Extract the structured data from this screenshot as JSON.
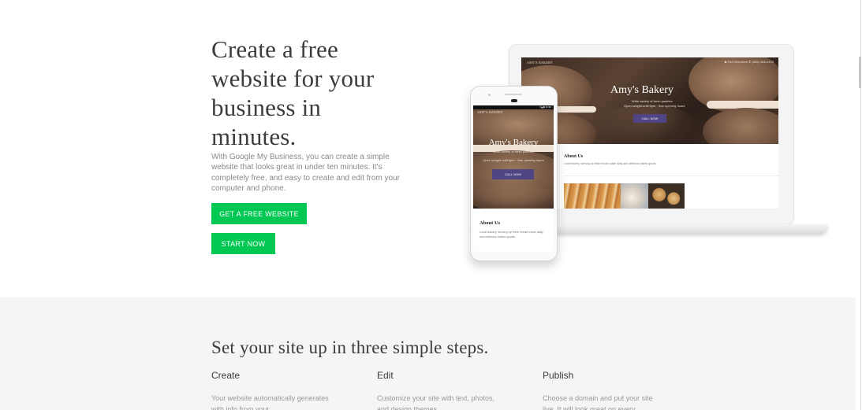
{
  "hero": {
    "title": "Create a free website for your business in minutes.",
    "description": "With Google My Business, you can create a simple website that looks great in under ten minutes. It's completely free, and easy to create and edit from your computer and phone.",
    "primary_button": "GET A FREE WEBSITE",
    "secondary_button": "START NOW",
    "button_color": "#00c853"
  },
  "laptop_preview": {
    "brand": "AMY'S BAKERY",
    "nav_right": "◆ Get Directions   ✆ (555) 555-0123",
    "title": "Amy's Bakery",
    "tagline": "Wide variety of fresh pastries",
    "hours": "Open tonight until 6pm · See opening hours",
    "call_button": "CALL NOW",
    "about_title": "About Us",
    "about_text": "Local bakery, serving up fresh bread made daily and delicious baked goods.",
    "accent_color": "#4f4584"
  },
  "phone_preview": {
    "status_text": "▾◢ ▮ 12:30",
    "brand": "AMY'S BAKERY",
    "title": "Amy's Bakery",
    "tagline": "Wide variety of fresh pastries",
    "hours": "Open tonight until 6pm · See opening hours",
    "call_button": "CALL NOW",
    "about_title": "About Us",
    "about_text": "Local bakery, serving up fresh bread made daily and delicious baked goods."
  },
  "steps_section": {
    "title": "Set your site up in three simple steps.",
    "background_color": "#f5f5f5",
    "steps": [
      {
        "heading": "Create",
        "text": "Your website automatically generates with info from your"
      },
      {
        "heading": "Edit",
        "text": "Customize your site with text, photos, and design themes"
      },
      {
        "heading": "Publish",
        "text": "Choose a domain and put your site live. It will look great on every"
      }
    ]
  }
}
